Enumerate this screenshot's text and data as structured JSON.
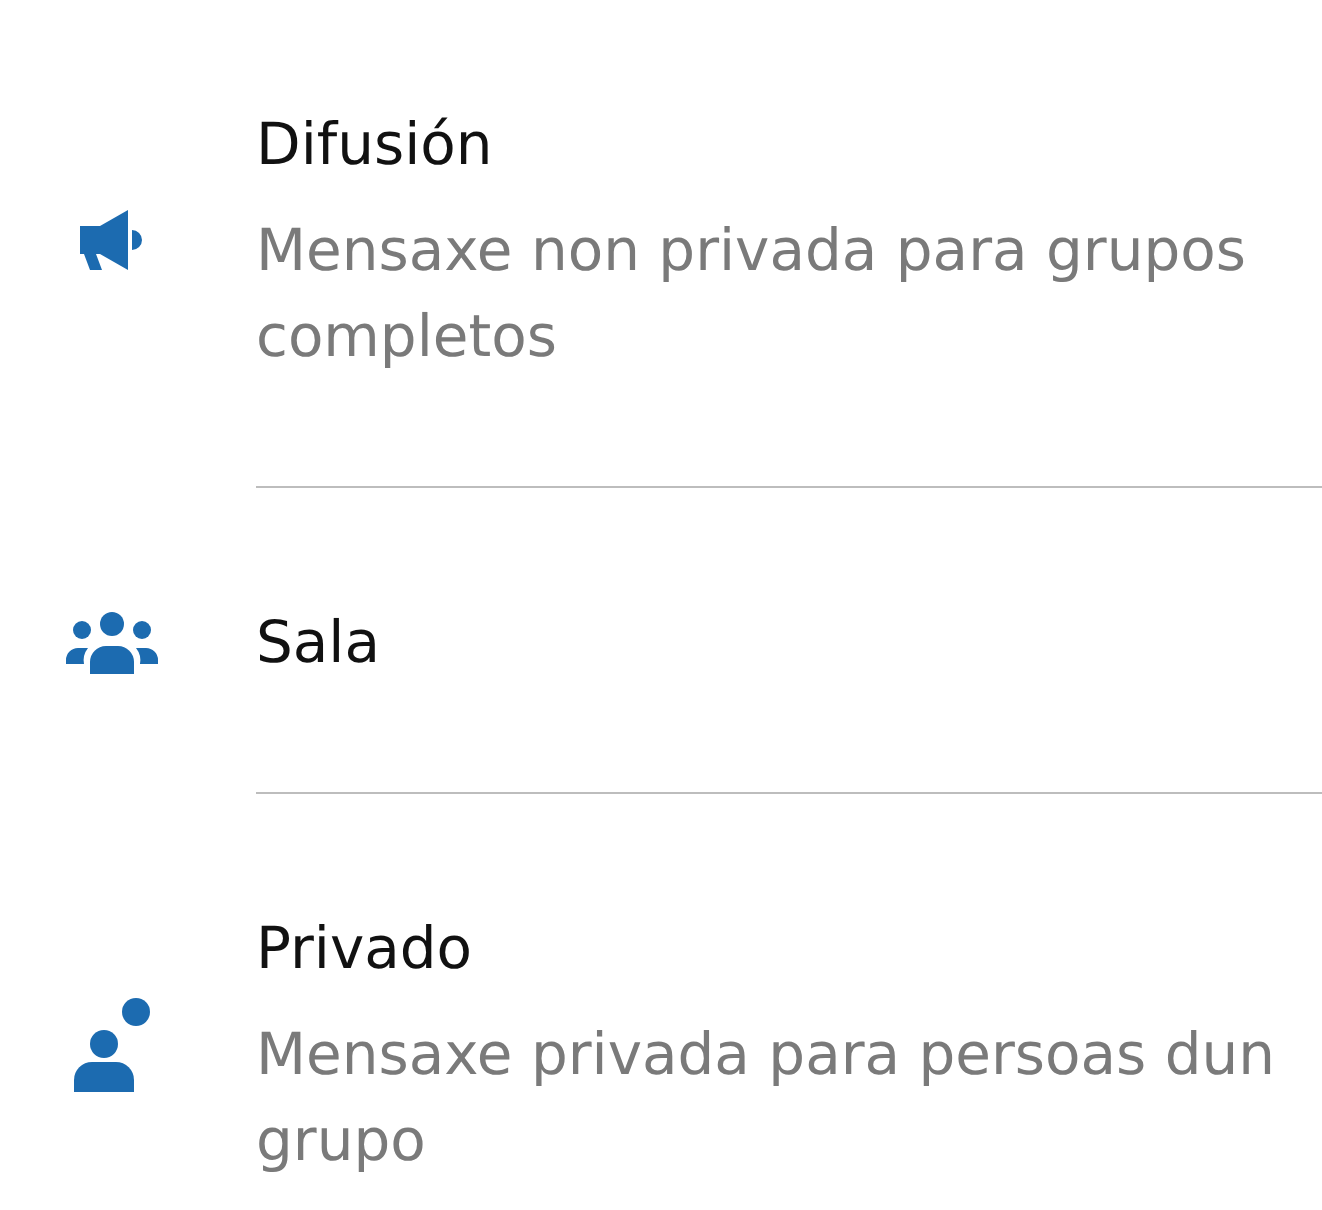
{
  "options": [
    {
      "title": "Difusión",
      "description": "Mensaxe non privada para grupos completos"
    },
    {
      "title": "Sala"
    },
    {
      "title": "Privado",
      "description": "Mensaxe privada para persoas dun grupo"
    }
  ]
}
